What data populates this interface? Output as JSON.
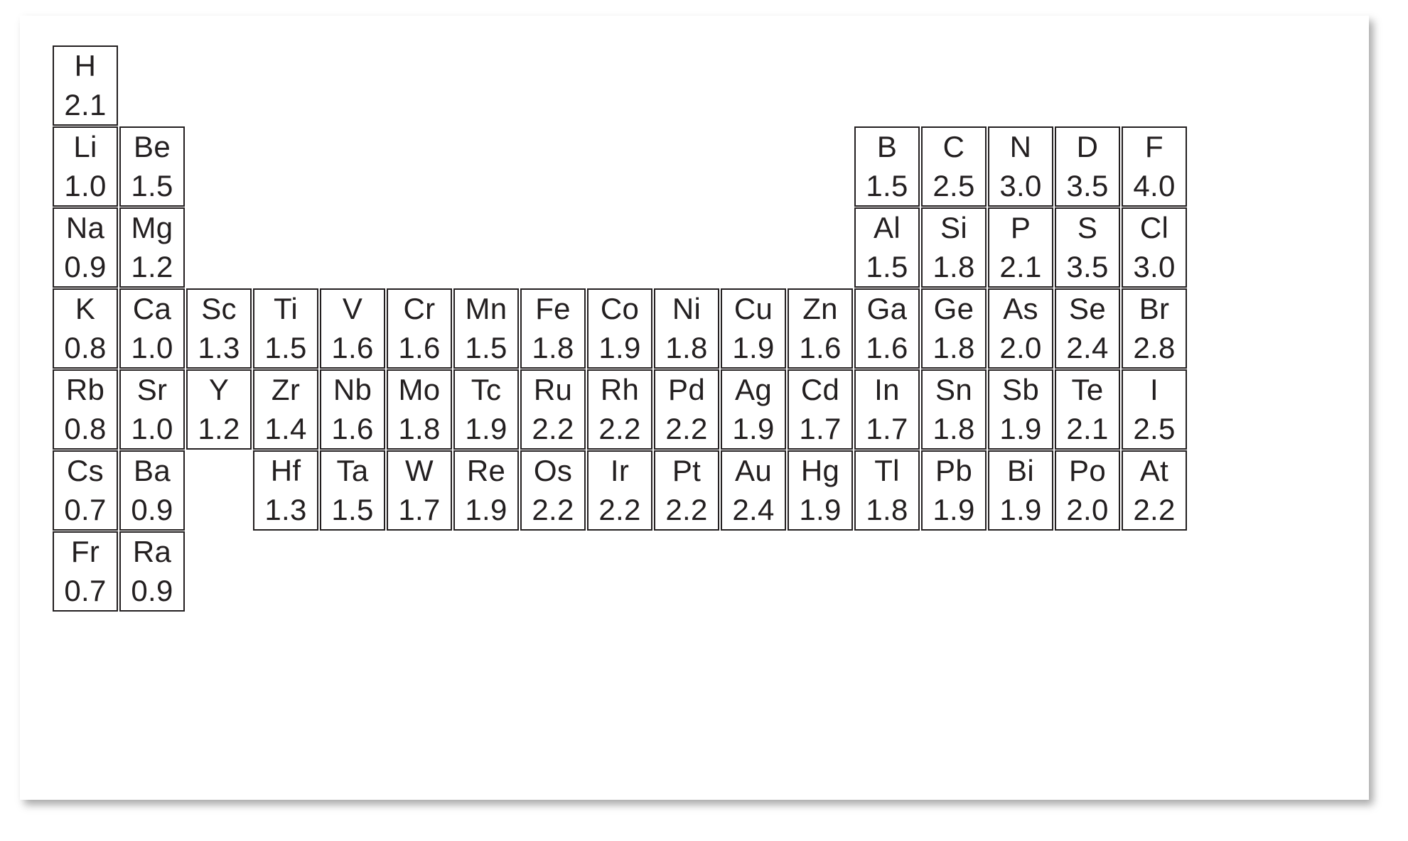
{
  "figure": {
    "type": "periodic-table-of-electronegativity",
    "background_color": "#ffffff",
    "card_color": "#ffffff",
    "border_color": "#231f20",
    "text_color": "#231f20"
  },
  "chart_data": {
    "type": "table",
    "title": "",
    "description": "Periodic table grid showing element symbols with Pauling electronegativity values",
    "columns": 18,
    "rows": 7,
    "value_label": "electronegativity",
    "value_range": [
      0.7,
      4.0
    ],
    "elements": [
      {
        "symbol": "H",
        "value": "2.1",
        "row": 1,
        "col": 1
      },
      {
        "symbol": "Li",
        "value": "1.0",
        "row": 2,
        "col": 1
      },
      {
        "symbol": "Be",
        "value": "1.5",
        "row": 2,
        "col": 2
      },
      {
        "symbol": "B",
        "value": "1.5",
        "row": 2,
        "col": 13
      },
      {
        "symbol": "C",
        "value": "2.5",
        "row": 2,
        "col": 14
      },
      {
        "symbol": "N",
        "value": "3.0",
        "row": 2,
        "col": 15
      },
      {
        "symbol": "D",
        "value": "3.5",
        "row": 2,
        "col": 16
      },
      {
        "symbol": "F",
        "value": "4.0",
        "row": 2,
        "col": 17
      },
      {
        "symbol": "Na",
        "value": "0.9",
        "row": 3,
        "col": 1
      },
      {
        "symbol": "Mg",
        "value": "1.2",
        "row": 3,
        "col": 2
      },
      {
        "symbol": "Al",
        "value": "1.5",
        "row": 3,
        "col": 13
      },
      {
        "symbol": "Si",
        "value": "1.8",
        "row": 3,
        "col": 14
      },
      {
        "symbol": "P",
        "value": "2.1",
        "row": 3,
        "col": 15
      },
      {
        "symbol": "S",
        "value": "3.5",
        "row": 3,
        "col": 16
      },
      {
        "symbol": "Cl",
        "value": "3.0",
        "row": 3,
        "col": 17
      },
      {
        "symbol": "K",
        "value": "0.8",
        "row": 4,
        "col": 1
      },
      {
        "symbol": "Ca",
        "value": "1.0",
        "row": 4,
        "col": 2
      },
      {
        "symbol": "Sc",
        "value": "1.3",
        "row": 4,
        "col": 3
      },
      {
        "symbol": "Ti",
        "value": "1.5",
        "row": 4,
        "col": 4
      },
      {
        "symbol": "V",
        "value": "1.6",
        "row": 4,
        "col": 5
      },
      {
        "symbol": "Cr",
        "value": "1.6",
        "row": 4,
        "col": 6
      },
      {
        "symbol": "Mn",
        "value": "1.5",
        "row": 4,
        "col": 7
      },
      {
        "symbol": "Fe",
        "value": "1.8",
        "row": 4,
        "col": 8
      },
      {
        "symbol": "Co",
        "value": "1.9",
        "row": 4,
        "col": 9
      },
      {
        "symbol": "Ni",
        "value": "1.8",
        "row": 4,
        "col": 10
      },
      {
        "symbol": "Cu",
        "value": "1.9",
        "row": 4,
        "col": 11
      },
      {
        "symbol": "Zn",
        "value": "1.6",
        "row": 4,
        "col": 12
      },
      {
        "symbol": "Ga",
        "value": "1.6",
        "row": 4,
        "col": 13
      },
      {
        "symbol": "Ge",
        "value": "1.8",
        "row": 4,
        "col": 14
      },
      {
        "symbol": "As",
        "value": "2.0",
        "row": 4,
        "col": 15
      },
      {
        "symbol": "Se",
        "value": "2.4",
        "row": 4,
        "col": 16
      },
      {
        "symbol": "Br",
        "value": "2.8",
        "row": 4,
        "col": 17
      },
      {
        "symbol": "Rb",
        "value": "0.8",
        "row": 5,
        "col": 1
      },
      {
        "symbol": "Sr",
        "value": "1.0",
        "row": 5,
        "col": 2
      },
      {
        "symbol": "Y",
        "value": "1.2",
        "row": 5,
        "col": 3
      },
      {
        "symbol": "Zr",
        "value": "1.4",
        "row": 5,
        "col": 4
      },
      {
        "symbol": "Nb",
        "value": "1.6",
        "row": 5,
        "col": 5
      },
      {
        "symbol": "Mo",
        "value": "1.8",
        "row": 5,
        "col": 6
      },
      {
        "symbol": "Tc",
        "value": "1.9",
        "row": 5,
        "col": 7
      },
      {
        "symbol": "Ru",
        "value": "2.2",
        "row": 5,
        "col": 8
      },
      {
        "symbol": "Rh",
        "value": "2.2",
        "row": 5,
        "col": 9
      },
      {
        "symbol": "Pd",
        "value": "2.2",
        "row": 5,
        "col": 10
      },
      {
        "symbol": "Ag",
        "value": "1.9",
        "row": 5,
        "col": 11
      },
      {
        "symbol": "Cd",
        "value": "1.7",
        "row": 5,
        "col": 12
      },
      {
        "symbol": "In",
        "value": "1.7",
        "row": 5,
        "col": 13
      },
      {
        "symbol": "Sn",
        "value": "1.8",
        "row": 5,
        "col": 14
      },
      {
        "symbol": "Sb",
        "value": "1.9",
        "row": 5,
        "col": 15
      },
      {
        "symbol": "Te",
        "value": "2.1",
        "row": 5,
        "col": 16
      },
      {
        "symbol": "I",
        "value": "2.5",
        "row": 5,
        "col": 17
      },
      {
        "symbol": "Cs",
        "value": "0.7",
        "row": 6,
        "col": 1
      },
      {
        "symbol": "Ba",
        "value": "0.9",
        "row": 6,
        "col": 2
      },
      {
        "symbol": "Hf",
        "value": "1.3",
        "row": 6,
        "col": 4
      },
      {
        "symbol": "Ta",
        "value": "1.5",
        "row": 6,
        "col": 5
      },
      {
        "symbol": "W",
        "value": "1.7",
        "row": 6,
        "col": 6
      },
      {
        "symbol": "Re",
        "value": "1.9",
        "row": 6,
        "col": 7
      },
      {
        "symbol": "Os",
        "value": "2.2",
        "row": 6,
        "col": 8
      },
      {
        "symbol": "Ir",
        "value": "2.2",
        "row": 6,
        "col": 9
      },
      {
        "symbol": "Pt",
        "value": "2.2",
        "row": 6,
        "col": 10
      },
      {
        "symbol": "Au",
        "value": "2.4",
        "row": 6,
        "col": 11
      },
      {
        "symbol": "Hg",
        "value": "1.9",
        "row": 6,
        "col": 12
      },
      {
        "symbol": "Tl",
        "value": "1.8",
        "row": 6,
        "col": 13
      },
      {
        "symbol": "Pb",
        "value": "1.9",
        "row": 6,
        "col": 14
      },
      {
        "symbol": "Bi",
        "value": "1.9",
        "row": 6,
        "col": 15
      },
      {
        "symbol": "Po",
        "value": "2.0",
        "row": 6,
        "col": 16
      },
      {
        "symbol": "At",
        "value": "2.2",
        "row": 6,
        "col": 17
      },
      {
        "symbol": "Fr",
        "value": "0.7",
        "row": 7,
        "col": 1
      },
      {
        "symbol": "Ra",
        "value": "0.9",
        "row": 7,
        "col": 2
      }
    ]
  }
}
